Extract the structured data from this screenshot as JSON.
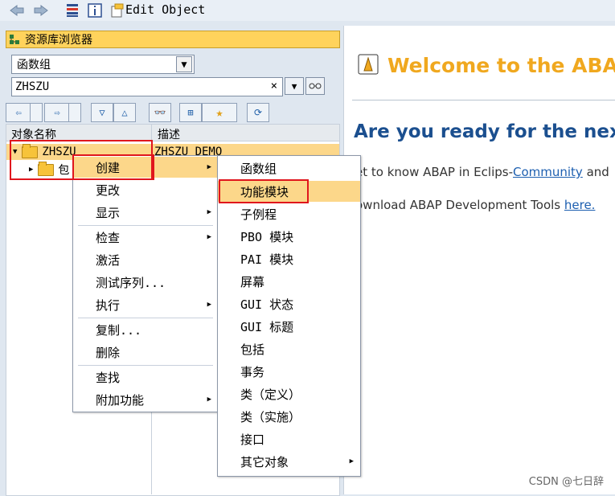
{
  "toolbar": {
    "title": "Edit Object"
  },
  "browser": {
    "title": "资源库浏览器",
    "object_type": "函数组",
    "object_name": "ZHSZU",
    "clear_symbol": "×"
  },
  "tree": {
    "col_name": "对象名称",
    "col_desc": "描述",
    "root": {
      "name": "ZHSZU",
      "desc": "ZHSZU DEMO"
    },
    "child": {
      "name": "包"
    }
  },
  "context_menu": {
    "items": [
      "创建",
      "更改",
      "显示",
      "检查",
      "激活",
      "测试序列...",
      "执行",
      "复制...",
      "删除",
      "查找",
      "附加功能"
    ]
  },
  "submenu": {
    "items": [
      "函数组",
      "功能模块",
      "子例程",
      "PBO 模块",
      "PAI 模块",
      "屏幕",
      "GUI 状态",
      "GUI 标题",
      "包括",
      "事务",
      "类（定义）",
      "类（实施）",
      "接口",
      "其它对象"
    ]
  },
  "welcome": {
    "title": "Welcome to the ABAP Y",
    "headline": "Are you ready for the next gen",
    "line1_prefix": "et to know ABAP in Eclips-",
    "line1_link": "Community",
    "line1_suffix": " and",
    "line2_prefix": "ownload ABAP Development Tools ",
    "line2_link": "here."
  },
  "watermark": "CSDN @七日辞",
  "colors": {
    "accent_orange": "#f0a81f",
    "headline_blue": "#1b4f8f",
    "highlight_yellow": "#fcd78a",
    "red_box": "#e0161d"
  }
}
